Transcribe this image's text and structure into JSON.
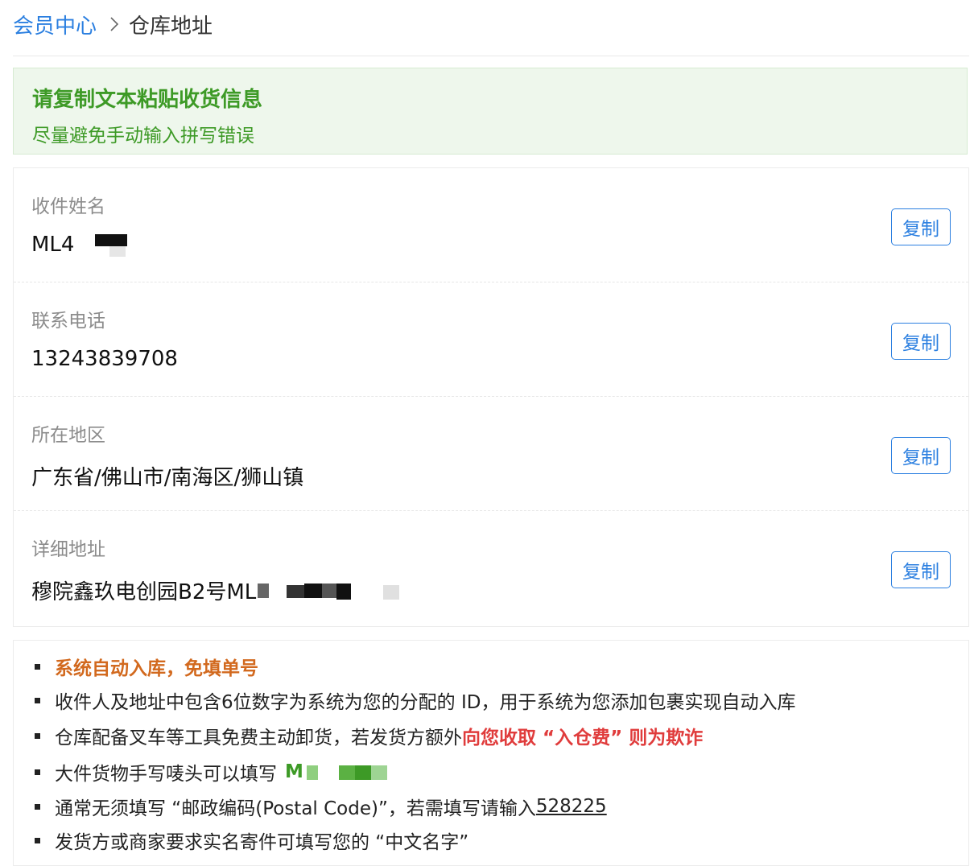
{
  "breadcrumb": {
    "parent": "会员中心",
    "current": "仓库地址"
  },
  "notice": {
    "title": "请复制文本粘贴收货信息",
    "subtitle": "尽量避免手动输入拼写错误"
  },
  "fields": [
    {
      "label": "收件姓名",
      "value": "ML4",
      "copy": "复制"
    },
    {
      "label": "联系电话",
      "value": "13243839708",
      "copy": "复制"
    },
    {
      "label": "所在地区",
      "value": "广东省/佛山市/南海区/狮山镇",
      "copy": "复制"
    },
    {
      "label": "详细地址",
      "value": "穆院鑫玖电创园B2号ML",
      "copy": "复制"
    }
  ],
  "tips": {
    "t1": "系统自动入库，免填单号",
    "t2": "收件人及地址中包含6位数字为系统为您的分配的 ID，用于系统为您添加包裹实现自动入库",
    "t3a": "仓库配备叉车等工具免费主动卸货，若发货方额外",
    "t3b": "向您收取 “入仓费” 则为欺诈",
    "t4a": "大件货物手写唛头可以填写",
    "t4b": "M",
    "t5a": "通常无须填写 “邮政编码(Postal Code)”，若需填写请输入 ",
    "t5b": "528225",
    "t6": "发货方或商家要求实名寄件可填写您的 “中文名字”"
  },
  "colors": {
    "link": "#2b7fe0",
    "green": "#3d9a26",
    "orange": "#d2691e",
    "red": "#e03c3c"
  }
}
